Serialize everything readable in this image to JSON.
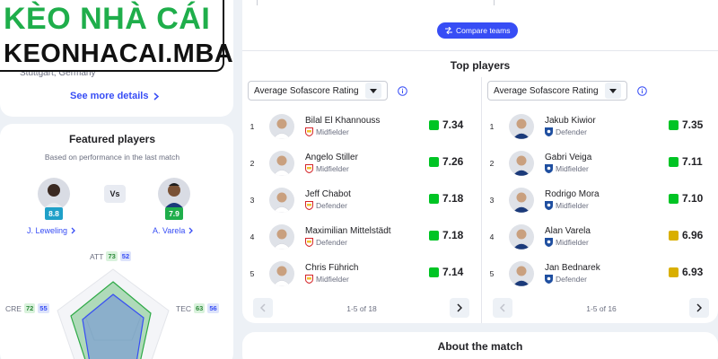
{
  "logo": {
    "line1": "KÈO NHÀ CÁI",
    "line2": "KEONHACAI.MBA"
  },
  "venue": {
    "city": "Stuttgart, Germany",
    "see_more": "See more details"
  },
  "featured": {
    "title": "Featured players",
    "subtitle": "Based on performance in the last match",
    "vs": "Vs",
    "player1": {
      "name": "J. Leweling",
      "rating": "8.8"
    },
    "player2": {
      "name": "A. Varela",
      "rating": "7.9"
    },
    "stats": {
      "att": {
        "label": "ATT",
        "p1": "73",
        "p2": "52"
      },
      "cre": {
        "label": "CRE",
        "p1": "72",
        "p2": "55"
      },
      "tec": {
        "label": "TEC",
        "p1": "63",
        "p2": "56"
      }
    }
  },
  "compare_button": "Compare teams",
  "top_players": {
    "title": "Top players",
    "left": {
      "select": "Average Sofascore Rating",
      "pager": "1-5 of 18",
      "players": [
        {
          "rank": "1",
          "name": "Bilal El Khannouss",
          "position": "Midfielder",
          "rating": "7.34",
          "color": "#00c424"
        },
        {
          "rank": "2",
          "name": "Angelo Stiller",
          "position": "Midfielder",
          "rating": "7.26",
          "color": "#00c424"
        },
        {
          "rank": "3",
          "name": "Jeff Chabot",
          "position": "Defender",
          "rating": "7.18",
          "color": "#00c424"
        },
        {
          "rank": "4",
          "name": "Maximilian Mittelstädt",
          "position": "Defender",
          "rating": "7.18",
          "color": "#00c424"
        },
        {
          "rank": "5",
          "name": "Chris Führich",
          "position": "Midfielder",
          "rating": "7.14",
          "color": "#00c424"
        }
      ]
    },
    "right": {
      "select": "Average Sofascore Rating",
      "pager": "1-5 of 16",
      "players": [
        {
          "rank": "1",
          "name": "Jakub Kiwior",
          "position": "Defender",
          "rating": "7.35",
          "color": "#00c424"
        },
        {
          "rank": "2",
          "name": "Gabri Veiga",
          "position": "Midfielder",
          "rating": "7.11",
          "color": "#00c424"
        },
        {
          "rank": "3",
          "name": "Rodrigo Mora",
          "position": "Midfielder",
          "rating": "7.10",
          "color": "#00c424"
        },
        {
          "rank": "4",
          "name": "Alan Varela",
          "position": "Midfielder",
          "rating": "6.96",
          "color": "#d9af00"
        },
        {
          "rank": "5",
          "name": "Jan Bednarek",
          "position": "Defender",
          "rating": "6.93",
          "color": "#d9af00"
        }
      ]
    }
  },
  "about": {
    "title": "About the match"
  },
  "colors": {
    "accent": "#374df5",
    "good": "#00c424",
    "ok": "#d9af00",
    "p1_stat": "#2e8a3b",
    "p2_stat": "#374df5"
  }
}
